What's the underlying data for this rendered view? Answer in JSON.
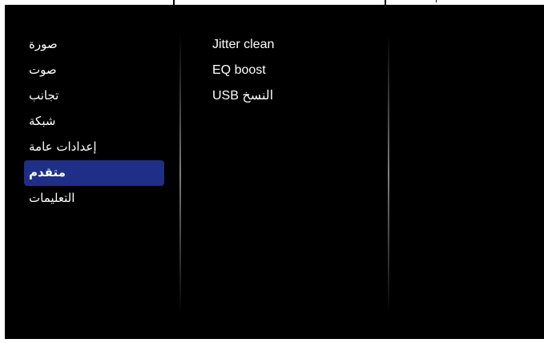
{
  "main_menu": {
    "items": [
      {
        "label": "صورة",
        "selected": false
      },
      {
        "label": "صوت",
        "selected": false
      },
      {
        "label": "تجانب",
        "selected": false
      },
      {
        "label": "شبكة",
        "selected": false
      },
      {
        "label": "إعدادات عامة",
        "selected": false
      },
      {
        "label": "متقدم",
        "selected": true
      },
      {
        "label": "التعليمات",
        "selected": false
      }
    ]
  },
  "submenu": {
    "items": [
      {
        "label": "Jitter clean"
      },
      {
        "label": "EQ boost"
      },
      {
        "label": "USB النسخ"
      }
    ]
  },
  "colors": {
    "background": "#000000",
    "selection": "#1f2e86",
    "text": "#ffffff"
  }
}
